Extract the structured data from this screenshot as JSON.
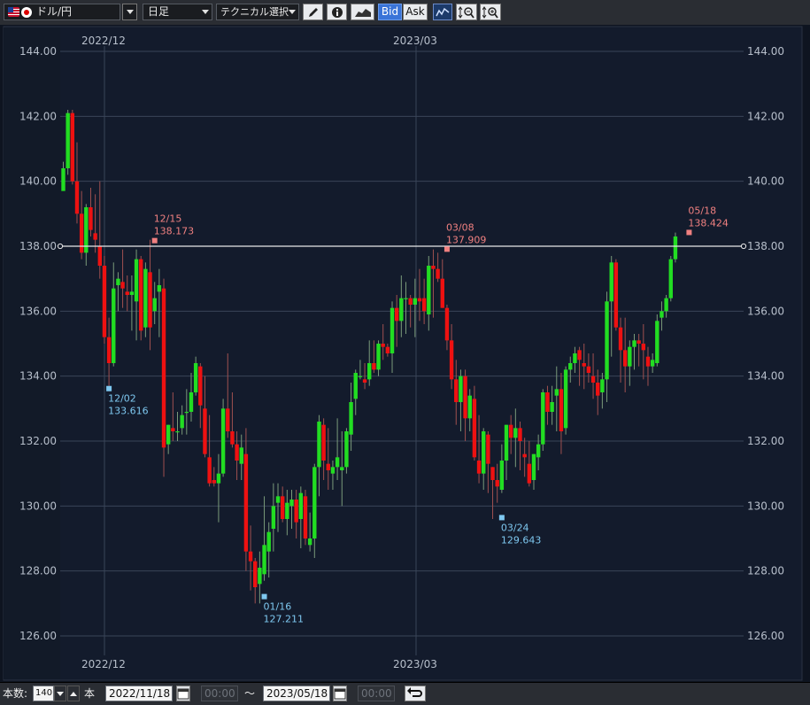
{
  "toolbar": {
    "currency_pair": "ドル/円",
    "timeframe": "日足",
    "technical_label": "テクニカル選択",
    "bid_label": "Bid",
    "ask_label": "Ask"
  },
  "bottom_bar": {
    "count_label": "本数:",
    "count_value": "140",
    "bars_unit": "本",
    "start_date": "2022/11/18",
    "start_time": "00:00",
    "range_sep": "〜",
    "end_date": "2023/05/18",
    "end_time": "00:00"
  },
  "colors": {
    "background": "#131b2c",
    "up": "#22dd22",
    "down": "#ee1111",
    "high_marker": "#f08080",
    "low_marker": "#7ec8f0",
    "grid": "#3a4558"
  },
  "chart_data": {
    "type": "candlestick",
    "ylim": [
      126,
      144
    ],
    "y_ticks": [
      "144.00",
      "142.00",
      "140.00",
      "138.00",
      "136.00",
      "134.00",
      "132.00",
      "130.00",
      "128.00",
      "126.00"
    ],
    "x_ticks": [
      "2022/12",
      "2023/03"
    ],
    "horizontal_line": 138.0,
    "annotations": [
      {
        "date": "12/02",
        "value": "133.616",
        "kind": "low"
      },
      {
        "date": "12/15",
        "value": "138.173",
        "kind": "high"
      },
      {
        "date": "01/16",
        "value": "127.211",
        "kind": "low"
      },
      {
        "date": "03/08",
        "value": "137.909",
        "kind": "high"
      },
      {
        "date": "03/24",
        "value": "129.643",
        "kind": "low"
      },
      {
        "date": "05/18",
        "value": "138.424",
        "kind": "high"
      }
    ],
    "candles": [
      [
        139.7,
        140.6,
        140.2,
        140.4
      ],
      [
        140.4,
        142.2,
        140.2,
        142.1
      ],
      [
        142.1,
        142.2,
        139.9,
        140.0
      ],
      [
        140.0,
        141.2,
        138.7,
        139.0
      ],
      [
        139.0,
        139.7,
        137.6,
        137.8
      ],
      [
        137.8,
        139.3,
        137.4,
        139.2
      ],
      [
        139.2,
        139.8,
        138.3,
        138.5
      ],
      [
        138.4,
        139.6,
        137.8,
        138.2
      ],
      [
        138.0,
        140.0,
        137.0,
        137.4
      ],
      [
        137.4,
        137.7,
        135.0,
        135.2
      ],
      [
        135.2,
        135.8,
        133.6,
        134.4
      ],
      [
        134.4,
        137.5,
        134.3,
        136.7
      ],
      [
        136.8,
        137.2,
        136.0,
        137.0
      ],
      [
        136.9,
        137.9,
        136.1,
        136.7
      ],
      [
        136.6,
        137.1,
        136.0,
        136.5
      ],
      [
        136.5,
        137.1,
        135.4,
        136.6
      ],
      [
        136.3,
        137.9,
        135.1,
        137.6
      ],
      [
        137.6,
        137.7,
        135.1,
        135.4
      ],
      [
        135.5,
        137.5,
        135.2,
        137.3
      ],
      [
        137.2,
        138.2,
        134.8,
        135.5
      ],
      [
        136.0,
        136.9,
        135.6,
        136.4
      ],
      [
        136.6,
        137.3,
        135.2,
        136.8
      ],
      [
        136.7,
        137.0,
        130.9,
        131.8
      ],
      [
        131.9,
        132.5,
        131.6,
        132.5
      ],
      [
        132.4,
        133.5,
        132.0,
        132.3
      ],
      [
        132.3,
        132.9,
        132.0,
        132.3
      ],
      [
        132.4,
        133.1,
        132.2,
        132.8
      ],
      [
        132.9,
        133.6,
        132.2,
        132.9
      ],
      [
        132.9,
        134.1,
        132.6,
        133.5
      ],
      [
        133.5,
        134.6,
        133.4,
        134.4
      ],
      [
        134.3,
        134.4,
        132.4,
        133.1
      ],
      [
        133.0,
        134.0,
        131.5,
        131.6
      ],
      [
        131.5,
        132.8,
        130.6,
        130.7
      ],
      [
        130.8,
        131.2,
        130.6,
        130.7
      ],
      [
        130.7,
        131.6,
        129.5,
        131.0
      ],
      [
        131.0,
        133.3,
        130.9,
        133.0
      ],
      [
        133.0,
        134.7,
        132.1,
        132.3
      ],
      [
        132.3,
        133.5,
        131.8,
        131.9
      ],
      [
        131.9,
        132.3,
        130.8,
        131.4
      ],
      [
        131.3,
        132.2,
        130.8,
        131.8
      ],
      [
        131.6,
        132.4,
        128.0,
        128.6
      ],
      [
        128.6,
        129.4,
        127.4,
        128.3
      ],
      [
        128.3,
        128.4,
        127.0,
        127.5
      ],
      [
        127.6,
        128.6,
        127.0,
        128.1
      ],
      [
        127.9,
        130.3,
        127.7,
        128.8
      ],
      [
        128.6,
        129.5,
        127.8,
        129.2
      ],
      [
        129.3,
        130.7,
        128.6,
        130.0
      ],
      [
        130.1,
        130.7,
        129.2,
        130.3
      ],
      [
        130.3,
        130.6,
        129.5,
        129.6
      ],
      [
        129.6,
        130.5,
        129.1,
        130.1
      ],
      [
        130.0,
        130.5,
        129.3,
        130.2
      ],
      [
        130.2,
        130.5,
        129.0,
        129.5
      ],
      [
        129.6,
        130.6,
        128.7,
        130.4
      ],
      [
        130.3,
        130.5,
        128.8,
        129.0
      ],
      [
        128.8,
        129.8,
        128.6,
        129.0
      ],
      [
        129.0,
        131.3,
        128.4,
        131.2
      ],
      [
        131.2,
        132.8,
        130.3,
        132.6
      ],
      [
        132.5,
        132.7,
        130.8,
        131.4
      ],
      [
        131.3,
        132.4,
        130.5,
        131.1
      ],
      [
        131.0,
        131.4,
        130.5,
        131.2
      ],
      [
        131.2,
        132.7,
        130.8,
        131.5
      ],
      [
        131.1,
        132.3,
        130.0,
        131.2
      ],
      [
        131.2,
        132.4,
        131.0,
        132.3
      ],
      [
        132.2,
        133.8,
        131.7,
        133.2
      ],
      [
        133.3,
        134.2,
        132.8,
        134.1
      ],
      [
        134.0,
        134.5,
        133.9,
        134.0
      ],
      [
        133.9,
        134.4,
        133.6,
        133.8
      ],
      [
        133.9,
        135.1,
        133.7,
        134.4
      ],
      [
        134.4,
        135.1,
        134.1,
        134.2
      ],
      [
        134.2,
        135.1,
        134.0,
        135.0
      ],
      [
        135.0,
        135.6,
        134.5,
        134.9
      ],
      [
        134.9,
        135.0,
        134.6,
        134.7
      ],
      [
        134.7,
        136.3,
        134.1,
        136.1
      ],
      [
        136.1,
        136.5,
        134.9,
        135.7
      ],
      [
        135.7,
        137.1,
        135.2,
        136.4
      ],
      [
        136.4,
        136.9,
        135.3,
        136.4
      ],
      [
        136.4,
        136.5,
        135.5,
        136.2
      ],
      [
        136.2,
        137.0,
        135.2,
        136.4
      ],
      [
        136.4,
        137.3,
        135.7,
        136.3
      ],
      [
        136.4,
        137.0,
        135.6,
        136.0
      ],
      [
        135.9,
        137.7,
        135.4,
        137.4
      ],
      [
        137.4,
        137.9,
        135.8,
        137.3
      ],
      [
        137.3,
        137.8,
        136.9,
        137.0
      ],
      [
        137.0,
        137.6,
        136.1,
        136.1
      ],
      [
        136.1,
        136.2,
        134.8,
        135.1
      ],
      [
        135.1,
        135.6,
        133.6,
        133.9
      ],
      [
        133.9,
        134.5,
        132.5,
        133.2
      ],
      [
        133.2,
        134.2,
        132.3,
        134.0
      ],
      [
        134.0,
        134.2,
        132.0,
        132.7
      ],
      [
        132.7,
        133.6,
        132.3,
        133.4
      ],
      [
        133.3,
        133.7,
        131.4,
        131.5
      ],
      [
        131.4,
        132.8,
        130.7,
        131.0
      ],
      [
        131.0,
        132.4,
        130.5,
        132.3
      ],
      [
        132.2,
        132.3,
        130.4,
        131.3
      ],
      [
        131.2,
        131.2,
        129.6,
        130.8
      ],
      [
        130.8,
        131.3,
        130.1,
        130.6
      ],
      [
        130.5,
        131.9,
        130.4,
        131.4
      ],
      [
        131.4,
        132.5,
        130.8,
        132.5
      ],
      [
        132.5,
        132.8,
        131.6,
        132.1
      ],
      [
        132.1,
        133.0,
        131.2,
        132.4
      ],
      [
        132.4,
        132.6,
        131.1,
        132.0
      ],
      [
        131.6,
        132.1,
        130.9,
        131.5
      ],
      [
        131.3,
        132.0,
        130.6,
        130.7
      ],
      [
        130.8,
        131.6,
        130.5,
        131.6
      ],
      [
        131.5,
        132.2,
        131.1,
        131.9
      ],
      [
        131.9,
        133.6,
        131.7,
        133.5
      ],
      [
        133.5,
        133.7,
        132.5,
        132.9
      ],
      [
        132.9,
        133.7,
        132.5,
        133.2
      ],
      [
        133.4,
        134.3,
        132.3,
        133.6
      ],
      [
        133.6,
        134.1,
        131.6,
        132.3
      ],
      [
        132.4,
        134.3,
        132.2,
        134.2
      ],
      [
        134.2,
        134.6,
        133.8,
        134.4
      ],
      [
        134.4,
        134.9,
        134.1,
        134.7
      ],
      [
        134.8,
        134.9,
        133.7,
        134.5
      ],
      [
        134.4,
        135.0,
        133.6,
        134.3
      ],
      [
        134.3,
        134.7,
        133.8,
        134.1
      ],
      [
        134.0,
        134.7,
        133.3,
        133.8
      ],
      [
        133.8,
        134.2,
        132.8,
        133.4
      ],
      [
        133.5,
        134.1,
        133.0,
        133.9
      ],
      [
        133.9,
        136.6,
        133.2,
        136.3
      ],
      [
        136.3,
        137.7,
        134.6,
        137.5
      ],
      [
        137.5,
        137.6,
        135.4,
        135.5
      ],
      [
        135.5,
        135.8,
        133.8,
        134.8
      ],
      [
        134.8,
        135.8,
        133.5,
        134.3
      ],
      [
        134.3,
        135.1,
        133.7,
        134.9
      ],
      [
        134.9,
        135.3,
        134.2,
        135.1
      ],
      [
        135.1,
        135.3,
        134.3,
        135.0
      ],
      [
        135.0,
        135.6,
        133.9,
        134.8
      ],
      [
        134.6,
        134.9,
        133.7,
        134.3
      ],
      [
        134.3,
        134.7,
        134.1,
        134.5
      ],
      [
        134.4,
        135.9,
        134.3,
        135.7
      ],
      [
        135.8,
        136.3,
        135.4,
        136.0
      ],
      [
        136.0,
        136.5,
        135.8,
        136.4
      ],
      [
        136.4,
        137.7,
        136.3,
        137.6
      ],
      [
        137.6,
        138.42,
        137.5,
        138.3
      ]
    ]
  }
}
